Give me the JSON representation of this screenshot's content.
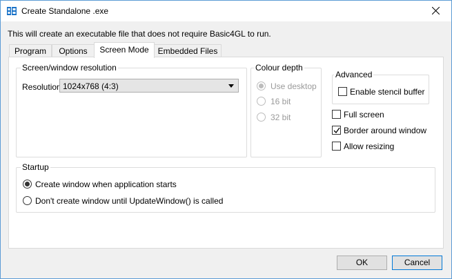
{
  "window": {
    "title": "Create Standalone .exe",
    "app_icon": "basic4gl-icon",
    "close_icon": "close-icon"
  },
  "description": "This will create an executable file that does not require Basic4GL to run.",
  "tabs": [
    {
      "label": "Program",
      "active": false
    },
    {
      "label": "Options",
      "active": false
    },
    {
      "label": "Screen Mode",
      "active": true
    },
    {
      "label": "Embedded Files",
      "active": false
    }
  ],
  "resolution_group": {
    "label": "Screen/window resolution",
    "field_label": "Resolution",
    "selected": "1024x768 (4:3)"
  },
  "colour_group": {
    "label": "Colour depth",
    "options": [
      {
        "label": "Use desktop",
        "selected": true
      },
      {
        "label": "16 bit",
        "selected": false
      },
      {
        "label": "32 bit",
        "selected": false
      }
    ]
  },
  "advanced_group": {
    "label": "Advanced",
    "stencil": {
      "label": "Enable stencil buffer",
      "checked": false
    }
  },
  "checkboxes": [
    {
      "label": "Full screen",
      "checked": false
    },
    {
      "label": "Border around window",
      "checked": true
    },
    {
      "label": "Allow resizing",
      "checked": false
    }
  ],
  "startup_group": {
    "label": "Startup",
    "options": [
      {
        "label": "Create window when application starts",
        "selected": true
      },
      {
        "label": "Don't create window until UpdateWindow() is called",
        "selected": false
      }
    ]
  },
  "buttons": {
    "ok": "OK",
    "cancel": "Cancel"
  }
}
